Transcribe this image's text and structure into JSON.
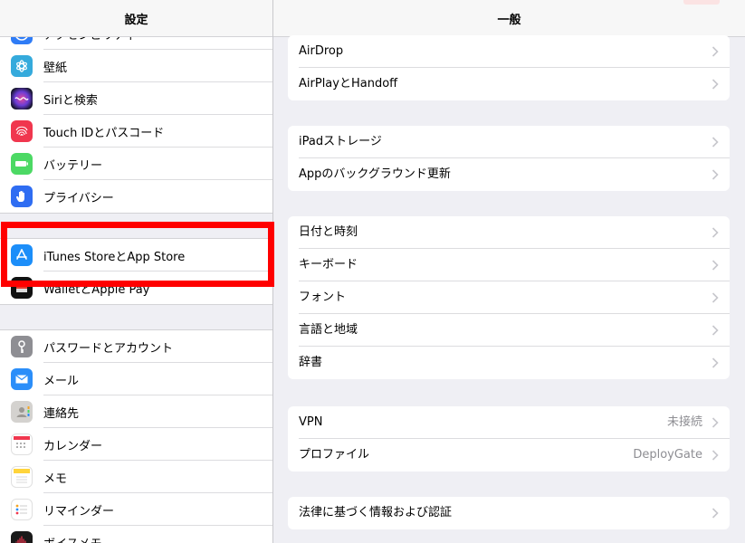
{
  "left_header": {
    "title": "設定"
  },
  "left_groups": [
    {
      "items": [
        {
          "label": "アクセシビリティ",
          "icon": "accessibility-icon",
          "color": "#2f7cf6"
        },
        {
          "label": "壁紙",
          "icon": "wallpaper-icon",
          "color": "#35aadc"
        },
        {
          "label": "Siriと検索",
          "icon": "siri-icon",
          "color": "#1a1a2e"
        },
        {
          "label": "Touch IDとパスコード",
          "icon": "fingerprint-icon",
          "color": "#f0364e"
        },
        {
          "label": "バッテリー",
          "icon": "battery-icon",
          "color": "#4cd964"
        },
        {
          "label": "プライバシー",
          "icon": "hand-icon",
          "color": "#2f6df2"
        }
      ]
    },
    {
      "items": [
        {
          "label": "iTunes StoreとApp Store",
          "icon": "app-store-icon",
          "color": "#1c8ef9"
        },
        {
          "label": "WalletとApple Pay",
          "icon": "wallet-icon",
          "color": "#111111"
        }
      ]
    },
    {
      "items": [
        {
          "label": "パスワードとアカウント",
          "icon": "key-icon",
          "color": "#8e8e93"
        },
        {
          "label": "メール",
          "icon": "mail-icon",
          "color": "#2b8ef9"
        },
        {
          "label": "連絡先",
          "icon": "contacts-icon",
          "color": "#c8c8c8"
        },
        {
          "label": "カレンダー",
          "icon": "calendar-icon",
          "color": "#ffffff"
        },
        {
          "label": "メモ",
          "icon": "notes-icon",
          "color": "#ffffff"
        },
        {
          "label": "リマインダー",
          "icon": "reminders-icon",
          "color": "#ffffff"
        },
        {
          "label": "ボイスメモ",
          "icon": "voice-memo-icon",
          "color": "#1a1a1a"
        }
      ]
    }
  ],
  "right_header": {
    "title": "一般"
  },
  "right_groups": [
    {
      "items": [
        {
          "label": "AirDrop"
        },
        {
          "label": "AirPlayとHandoff"
        }
      ]
    },
    {
      "items": [
        {
          "label": "iPadストレージ"
        },
        {
          "label": "Appのバックグラウンド更新"
        }
      ]
    },
    {
      "items": [
        {
          "label": "日付と時刻"
        },
        {
          "label": "キーボード"
        },
        {
          "label": "フォント"
        },
        {
          "label": "言語と地域"
        },
        {
          "label": "辞書"
        }
      ]
    },
    {
      "items": [
        {
          "label": "VPN",
          "value": "未接続"
        },
        {
          "label": "プロファイル",
          "value": "DeployGate"
        }
      ]
    },
    {
      "items": [
        {
          "label": "法律に基づく情報および認証"
        }
      ]
    }
  ],
  "colors": {
    "highlight": "#ff0000",
    "background": "#efeff4",
    "chevron": "#c7c7cc"
  }
}
